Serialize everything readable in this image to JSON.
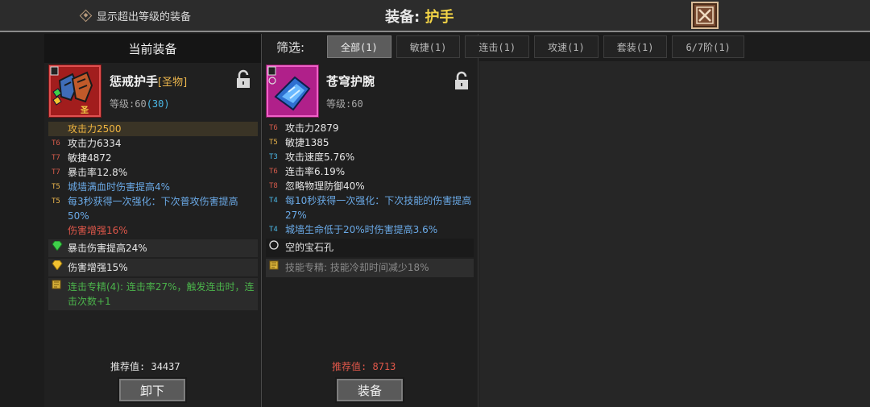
{
  "header": {
    "toggle_label": "显示超出等级的装备",
    "title_label": "装备:",
    "title_value": "护手"
  },
  "current": {
    "panel_title": "当前装备",
    "name": "惩戒护手",
    "tag": "[圣物]",
    "level_label": "等级:60",
    "level_extra": "(30)",
    "stats": [
      {
        "tier": "",
        "text": "攻击力2500",
        "tcls": "gold",
        "cls": "gold hl"
      },
      {
        "tier": "T6",
        "text": "攻击力6334",
        "tcls": "t6",
        "cls": "white"
      },
      {
        "tier": "T7",
        "text": "敏捷4872",
        "tcls": "t7",
        "cls": "white"
      },
      {
        "tier": "T7",
        "text": "暴击率12.8%",
        "tcls": "t7",
        "cls": "white"
      },
      {
        "tier": "T5",
        "text": "城墙满血时伤害提高4%",
        "tcls": "t5",
        "cls": "blue"
      },
      {
        "tier": "T5",
        "text": "每3秒获得一次强化：下次普攻伤害提高50%",
        "tcls": "t5",
        "cls": "blue"
      },
      {
        "tier": "",
        "text": "伤害增强16%",
        "tcls": "",
        "cls": "red"
      }
    ],
    "gem1": "暴击伤害提高24%",
    "gem2": "伤害增强15%",
    "set_text": "连击专精(4): 连击率27%，触发连击时，连击次数+1",
    "rec_label": "推荐值:",
    "rec_value": "34437",
    "unequip": "卸下"
  },
  "filter": {
    "label": "筛选:",
    "chips": [
      "全部(1)",
      "敏捷(1)",
      "连击(1)",
      "攻速(1)",
      "套装(1)",
      "6/7阶(1)"
    ]
  },
  "candidate": {
    "name": "苍穹护腕",
    "level_label": "等级:60",
    "stats": [
      {
        "tier": "T6",
        "text": "攻击力2879",
        "tcls": "t6",
        "cls": "white"
      },
      {
        "tier": "T5",
        "text": "敏捷1385",
        "tcls": "t5",
        "cls": "white"
      },
      {
        "tier": "T3",
        "text": "攻击速度5.76%",
        "tcls": "t3",
        "cls": "white"
      },
      {
        "tier": "T6",
        "text": "连击率6.19%",
        "tcls": "t6",
        "cls": "white"
      },
      {
        "tier": "T8",
        "text": "忽略物理防御40%",
        "tcls": "t8",
        "cls": "white"
      },
      {
        "tier": "T4",
        "text": "每10秒获得一次强化：下次技能的伤害提高27%",
        "tcls": "t4",
        "cls": "blue"
      },
      {
        "tier": "T4",
        "text": "城墙生命低于20%时伤害提高3.6%",
        "tcls": "t4",
        "cls": "blue"
      }
    ],
    "socket": "空的宝石孔",
    "set_text": "技能专精: 技能冷却时间减少18%",
    "rec_label": "推荐值:",
    "rec_value": "8713",
    "equip": "装备"
  },
  "colors": {
    "accent": "#f2d346",
    "red": "#e0574a",
    "blue": "#6aa9e6",
    "green": "#4bb34b"
  }
}
